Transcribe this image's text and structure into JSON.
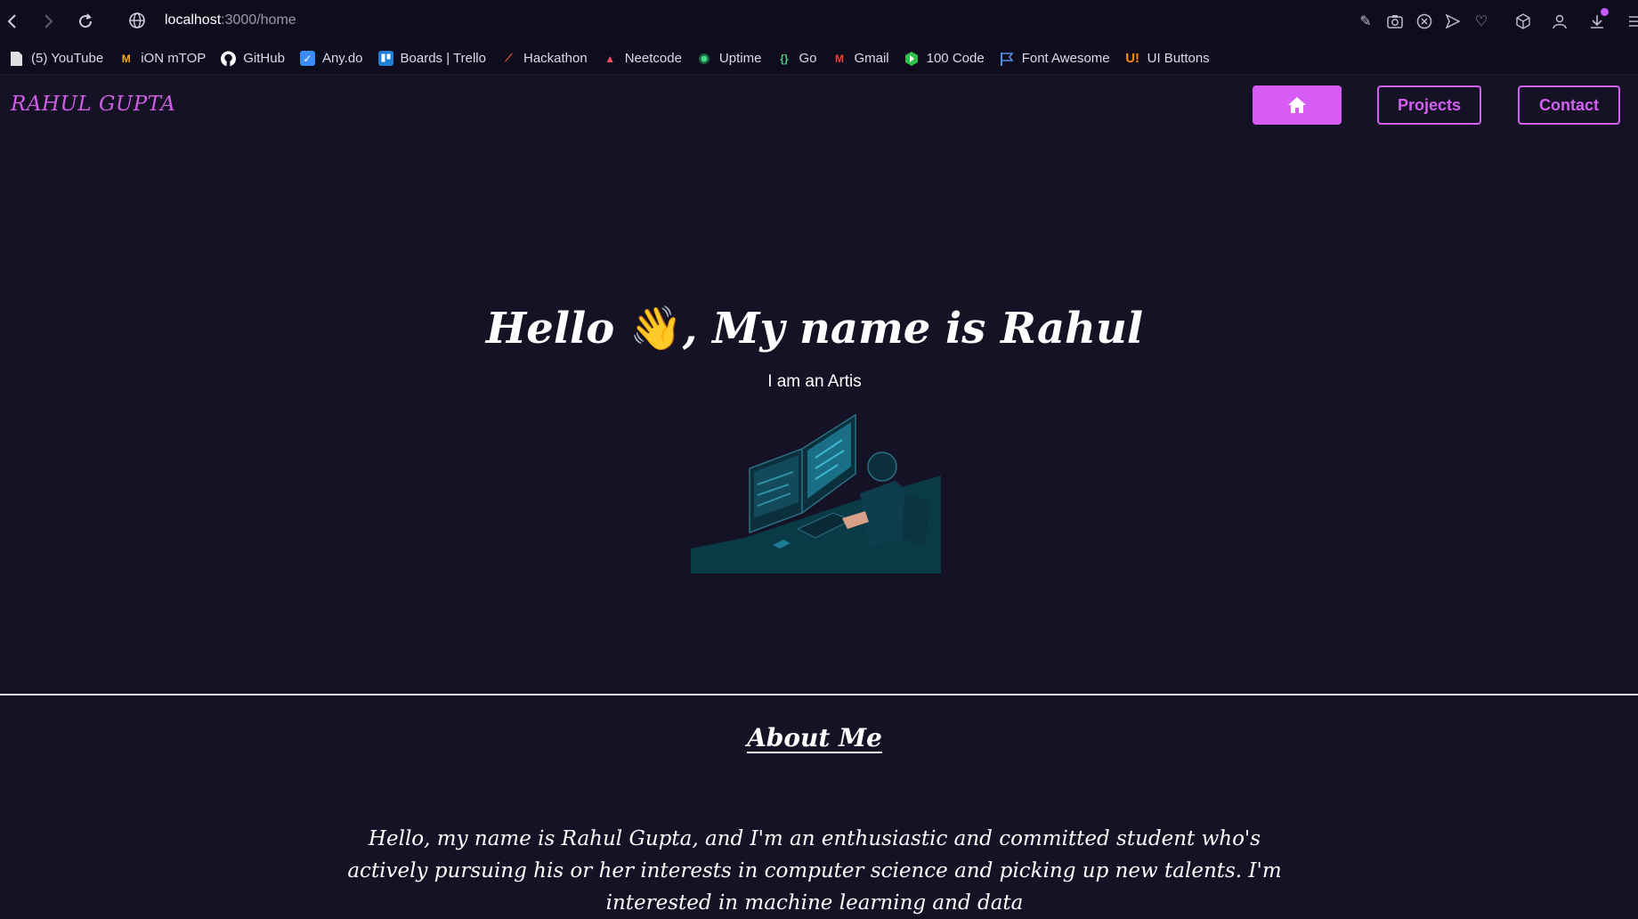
{
  "browser": {
    "url_host": "localhost",
    "url_path": ":3000/home",
    "bookmarks": [
      {
        "label": "(5) YouTube",
        "icon": "page-icon",
        "color": "#e0e0e0"
      },
      {
        "label": "iON mTOP",
        "icon": "ion-icon",
        "color": "#f5a623"
      },
      {
        "label": "GitHub",
        "icon": "github-icon",
        "color": "#ffffff"
      },
      {
        "label": "Any.do",
        "icon": "anydo-icon",
        "color": "#3b8cf6"
      },
      {
        "label": "Boards | Trello",
        "icon": "trello-icon",
        "color": "#1f7fd6"
      },
      {
        "label": "Hackathon",
        "icon": "hackathon-icon",
        "color": "#e8543a"
      },
      {
        "label": "Neetcode",
        "icon": "rocket-icon",
        "color": "#ff4d5a"
      },
      {
        "label": "Uptime",
        "icon": "uptime-icon",
        "color": "#3ddc84"
      },
      {
        "label": "Go",
        "icon": "go-icon",
        "color": "#46d27f"
      },
      {
        "label": "Gmail",
        "icon": "gmail-icon",
        "color": "#ea4335"
      },
      {
        "label": "100 Code",
        "icon": "hundred-code-icon",
        "color": "#2fbf4a"
      },
      {
        "label": "Font Awesome",
        "icon": "flag-icon",
        "color": "#4a90e2"
      },
      {
        "label": "UI Buttons",
        "icon": "ui-buttons-icon",
        "color": "#ff8a00"
      }
    ]
  },
  "site": {
    "logo": "RAHUL GUPTA",
    "nav": {
      "home_icon": "home-icon",
      "projects": "Projects",
      "contact": "Contact"
    },
    "accent": "#d65cf5",
    "background": "#151226"
  },
  "hero": {
    "title_before": "Hello ",
    "wave_emoji": "👋",
    "title_after": ", My name is Rahul",
    "subtitle": "I am an Artis"
  },
  "about": {
    "title": "About Me",
    "text": "Hello, my name is Rahul Gupta, and I'm an enthusiastic and committed student who's actively pursuing his or her interests in computer science and picking up new talents. I'm interested in machine learning and data"
  }
}
